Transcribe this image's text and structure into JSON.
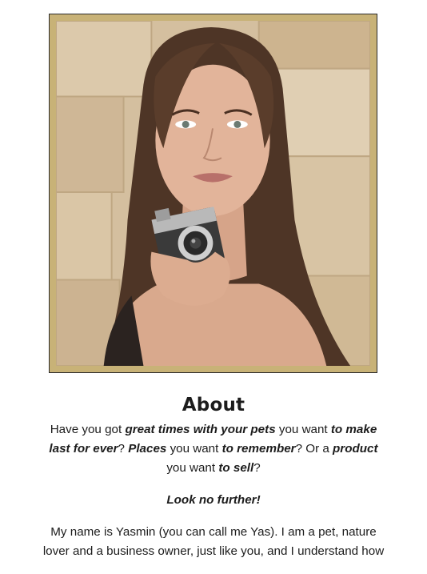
{
  "photo": {
    "alt": "Woman holding a vintage camera"
  },
  "about": {
    "heading": "About",
    "intro": [
      {
        "text": "Have you got ",
        "style": "normal"
      },
      {
        "text": "great times with your pets",
        "style": "bold-italic"
      },
      {
        "text": " you want ",
        "style": "normal"
      },
      {
        "text": "to make last for ever",
        "style": "bold-italic"
      },
      {
        "text": "? ",
        "style": "normal"
      },
      {
        "text": "Places",
        "style": "bold-italic"
      },
      {
        "text": " you want ",
        "style": "normal"
      },
      {
        "text": "to remember",
        "style": "bold-italic"
      },
      {
        "text": "? Or a ",
        "style": "normal"
      },
      {
        "text": "product",
        "style": "bold-italic"
      },
      {
        "text": " you want ",
        "style": "normal"
      },
      {
        "text": "to sell",
        "style": "bold-italic"
      },
      {
        "text": "?",
        "style": "normal"
      }
    ],
    "cta": "Look no further!",
    "bio": "My name is Yasmin (you can call me Yas). I am a pet, nature lover and a business owner, just like you, and I understand how"
  },
  "colors": {
    "frame": "#c8b277",
    "text": "#1c1c1c"
  }
}
